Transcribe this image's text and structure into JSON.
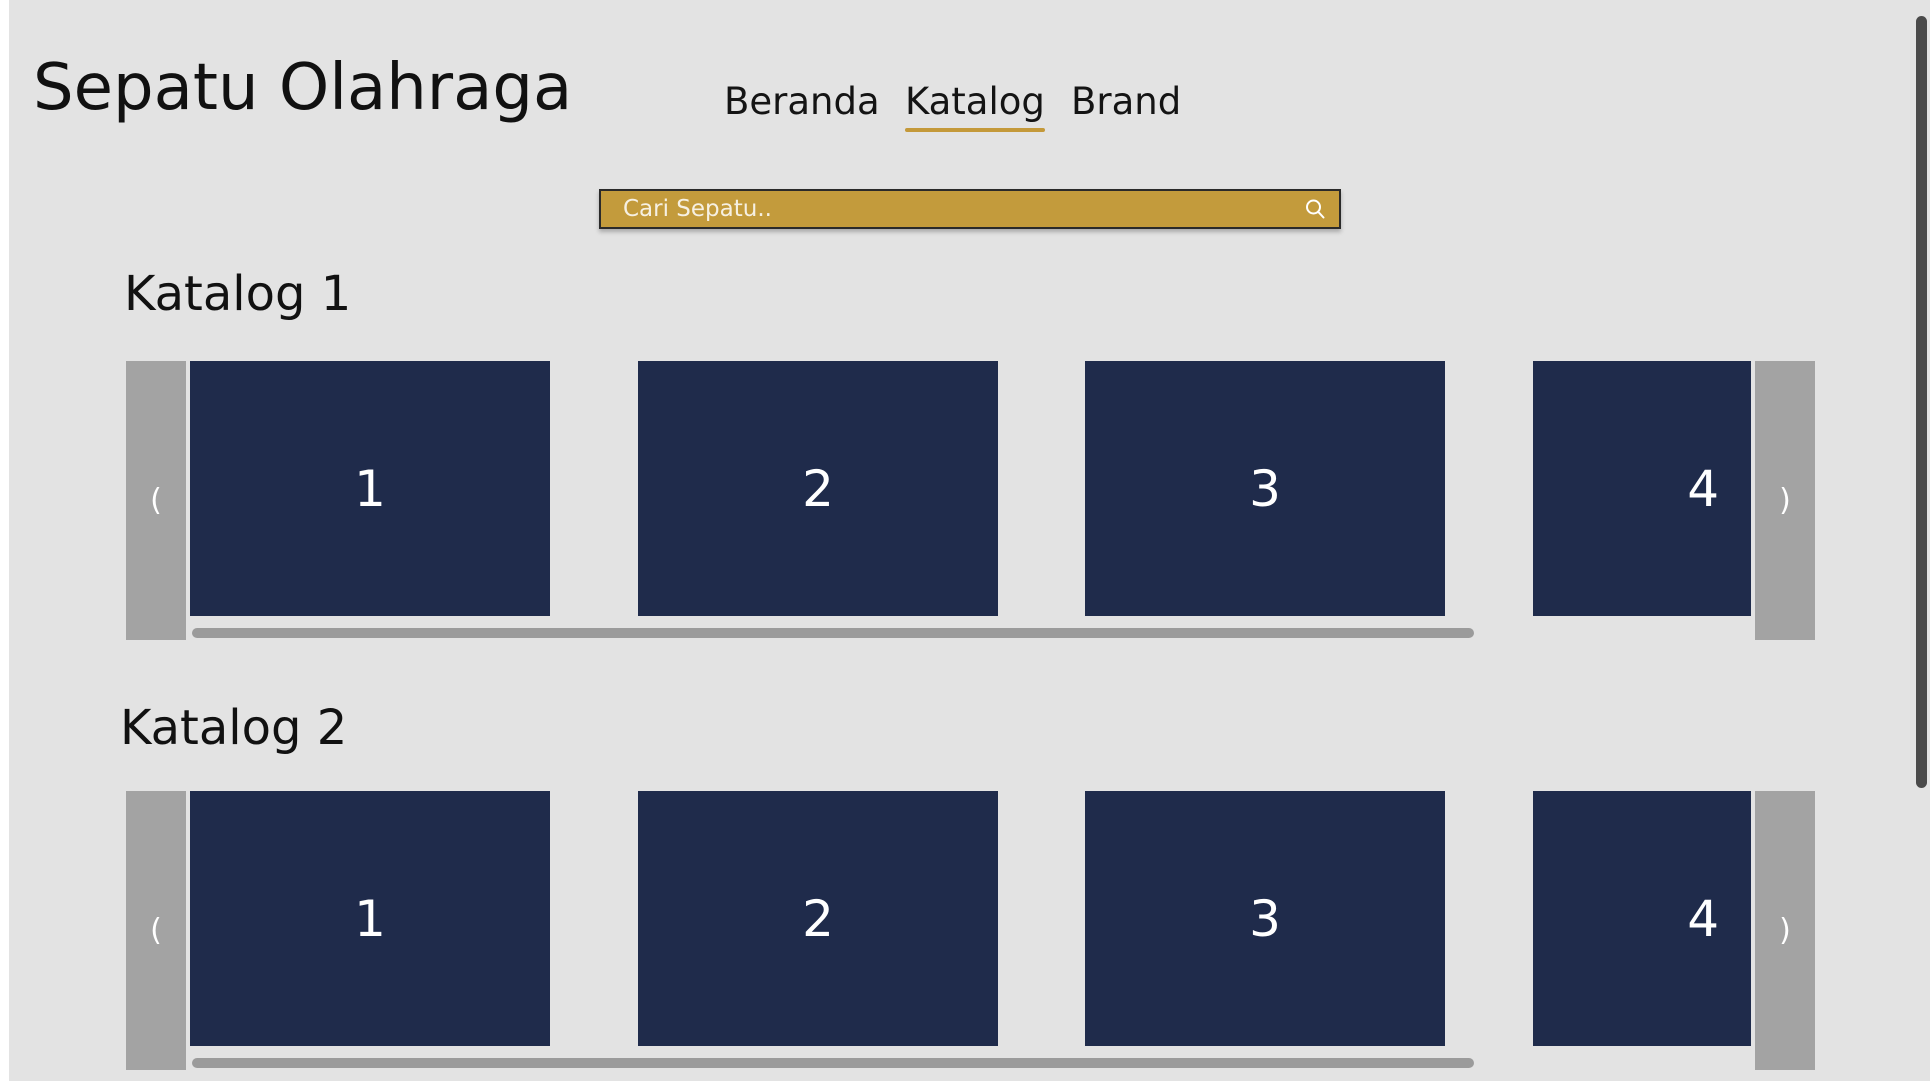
{
  "app": {
    "title": "Sepatu Olahraga"
  },
  "nav": {
    "items": [
      {
        "label": "Beranda",
        "active": false
      },
      {
        "label": "Katalog",
        "active": true
      },
      {
        "label": "Brand",
        "active": false
      }
    ]
  },
  "search": {
    "placeholder": "Cari Sepatu..",
    "value": "",
    "icon": "search-icon"
  },
  "colors": {
    "page_background": "#e3e3e3",
    "accent": "#c39b3c",
    "card": "#1f2b4b",
    "carousel_arrow": "#a3a3a3"
  },
  "catalogs": [
    {
      "title": "Katalog 1",
      "prev_label": "(",
      "next_label": ")",
      "cards": [
        "1",
        "2",
        "3",
        "4"
      ]
    },
    {
      "title": "Katalog 2",
      "prev_label": "(",
      "next_label": ")",
      "cards": [
        "1",
        "2",
        "3",
        "4"
      ]
    }
  ]
}
